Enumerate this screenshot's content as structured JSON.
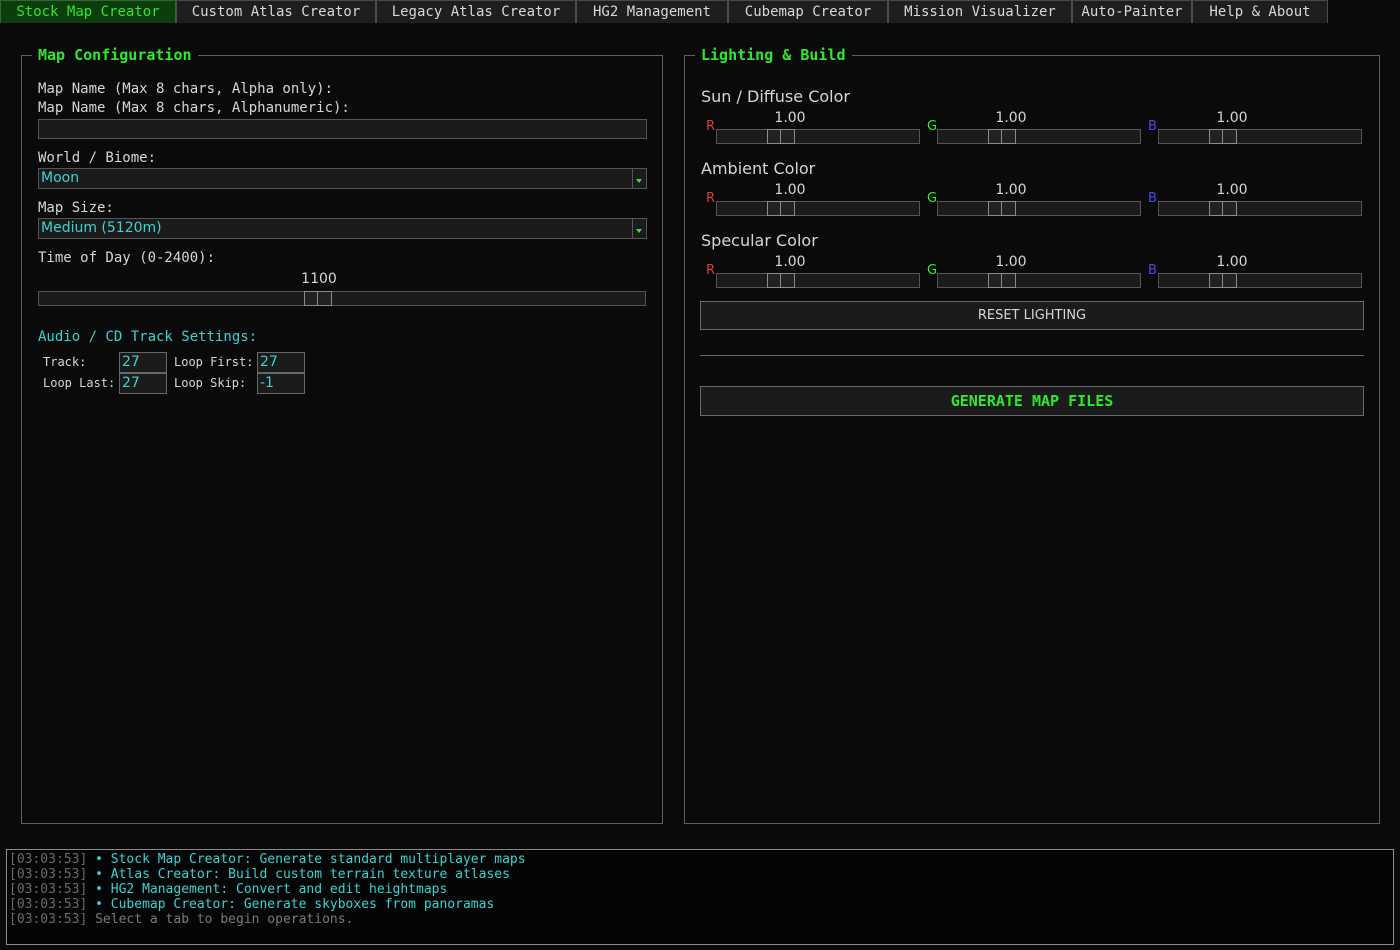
{
  "tabs": [
    {
      "label": "Stock Map Creator",
      "active": true
    },
    {
      "label": "Custom Atlas Creator",
      "active": false
    },
    {
      "label": "Legacy Atlas Creator",
      "active": false
    },
    {
      "label": "HG2 Management",
      "active": false
    },
    {
      "label": "Cubemap Creator",
      "active": false
    },
    {
      "label": "Mission Visualizer",
      "active": false
    },
    {
      "label": "Auto-Painter",
      "active": false
    },
    {
      "label": "Help & About",
      "active": false
    }
  ],
  "map_config": {
    "title": "Map Configuration",
    "name_label_1": "Map Name (Max 8 chars, Alpha only):",
    "name_label_2": "Map Name (Max 8 chars, Alphanumeric):",
    "name_value": "",
    "biome_label": "World / Biome:",
    "biome_value": "Moon",
    "size_label": "Map Size:",
    "size_value": "Medium (5120m)",
    "tod_label": "Time of Day (0-2400):",
    "tod_value": "1100",
    "tod_fraction": 0.458,
    "audio_header": "Audio / CD Track Settings:",
    "audio": {
      "track_label": "Track:",
      "track_value": "27",
      "loop_first_label": "Loop First:",
      "loop_first_value": "27",
      "loop_last_label": "Loop Last:",
      "loop_last_value": "27",
      "loop_skip_label": "Loop Skip:",
      "loop_skip_value": "-1"
    }
  },
  "lighting": {
    "title": "Lighting & Build",
    "channel_labels": {
      "r": "R",
      "g": "G",
      "b": "B"
    },
    "channel_colors": {
      "r": "#e03c3c",
      "g": "#2ee82e",
      "b": "#4a4ae8"
    },
    "sections": [
      {
        "title": "Sun / Diffuse Color",
        "r": "1.00",
        "g": "1.00",
        "b": "1.00"
      },
      {
        "title": "Ambient Color",
        "r": "1.00",
        "g": "1.00",
        "b": "1.00"
      },
      {
        "title": "Specular Color",
        "r": "1.00",
        "g": "1.00",
        "b": "1.00"
      }
    ],
    "slider_fraction": 0.29,
    "reset_label": "RESET LIGHTING",
    "generate_label": "GENERATE MAP FILES"
  },
  "console": {
    "lines": [
      {
        "ts": "[03:03:53]",
        "msg": " • Stock Map Creator: Generate standard multiplayer maps",
        "style": "cyan"
      },
      {
        "ts": "[03:03:53]",
        "msg": " • Atlas Creator: Build custom terrain texture atlases",
        "style": "cyan"
      },
      {
        "ts": "[03:03:53]",
        "msg": " • HG2 Management: Convert and edit heightmaps",
        "style": "cyan"
      },
      {
        "ts": "[03:03:53]",
        "msg": " • Cubemap Creator: Generate skyboxes from panoramas",
        "style": "cyan"
      },
      {
        "ts": "[03:03:53]",
        "msg": " Select a tab to begin operations.",
        "style": "gray"
      }
    ]
  }
}
